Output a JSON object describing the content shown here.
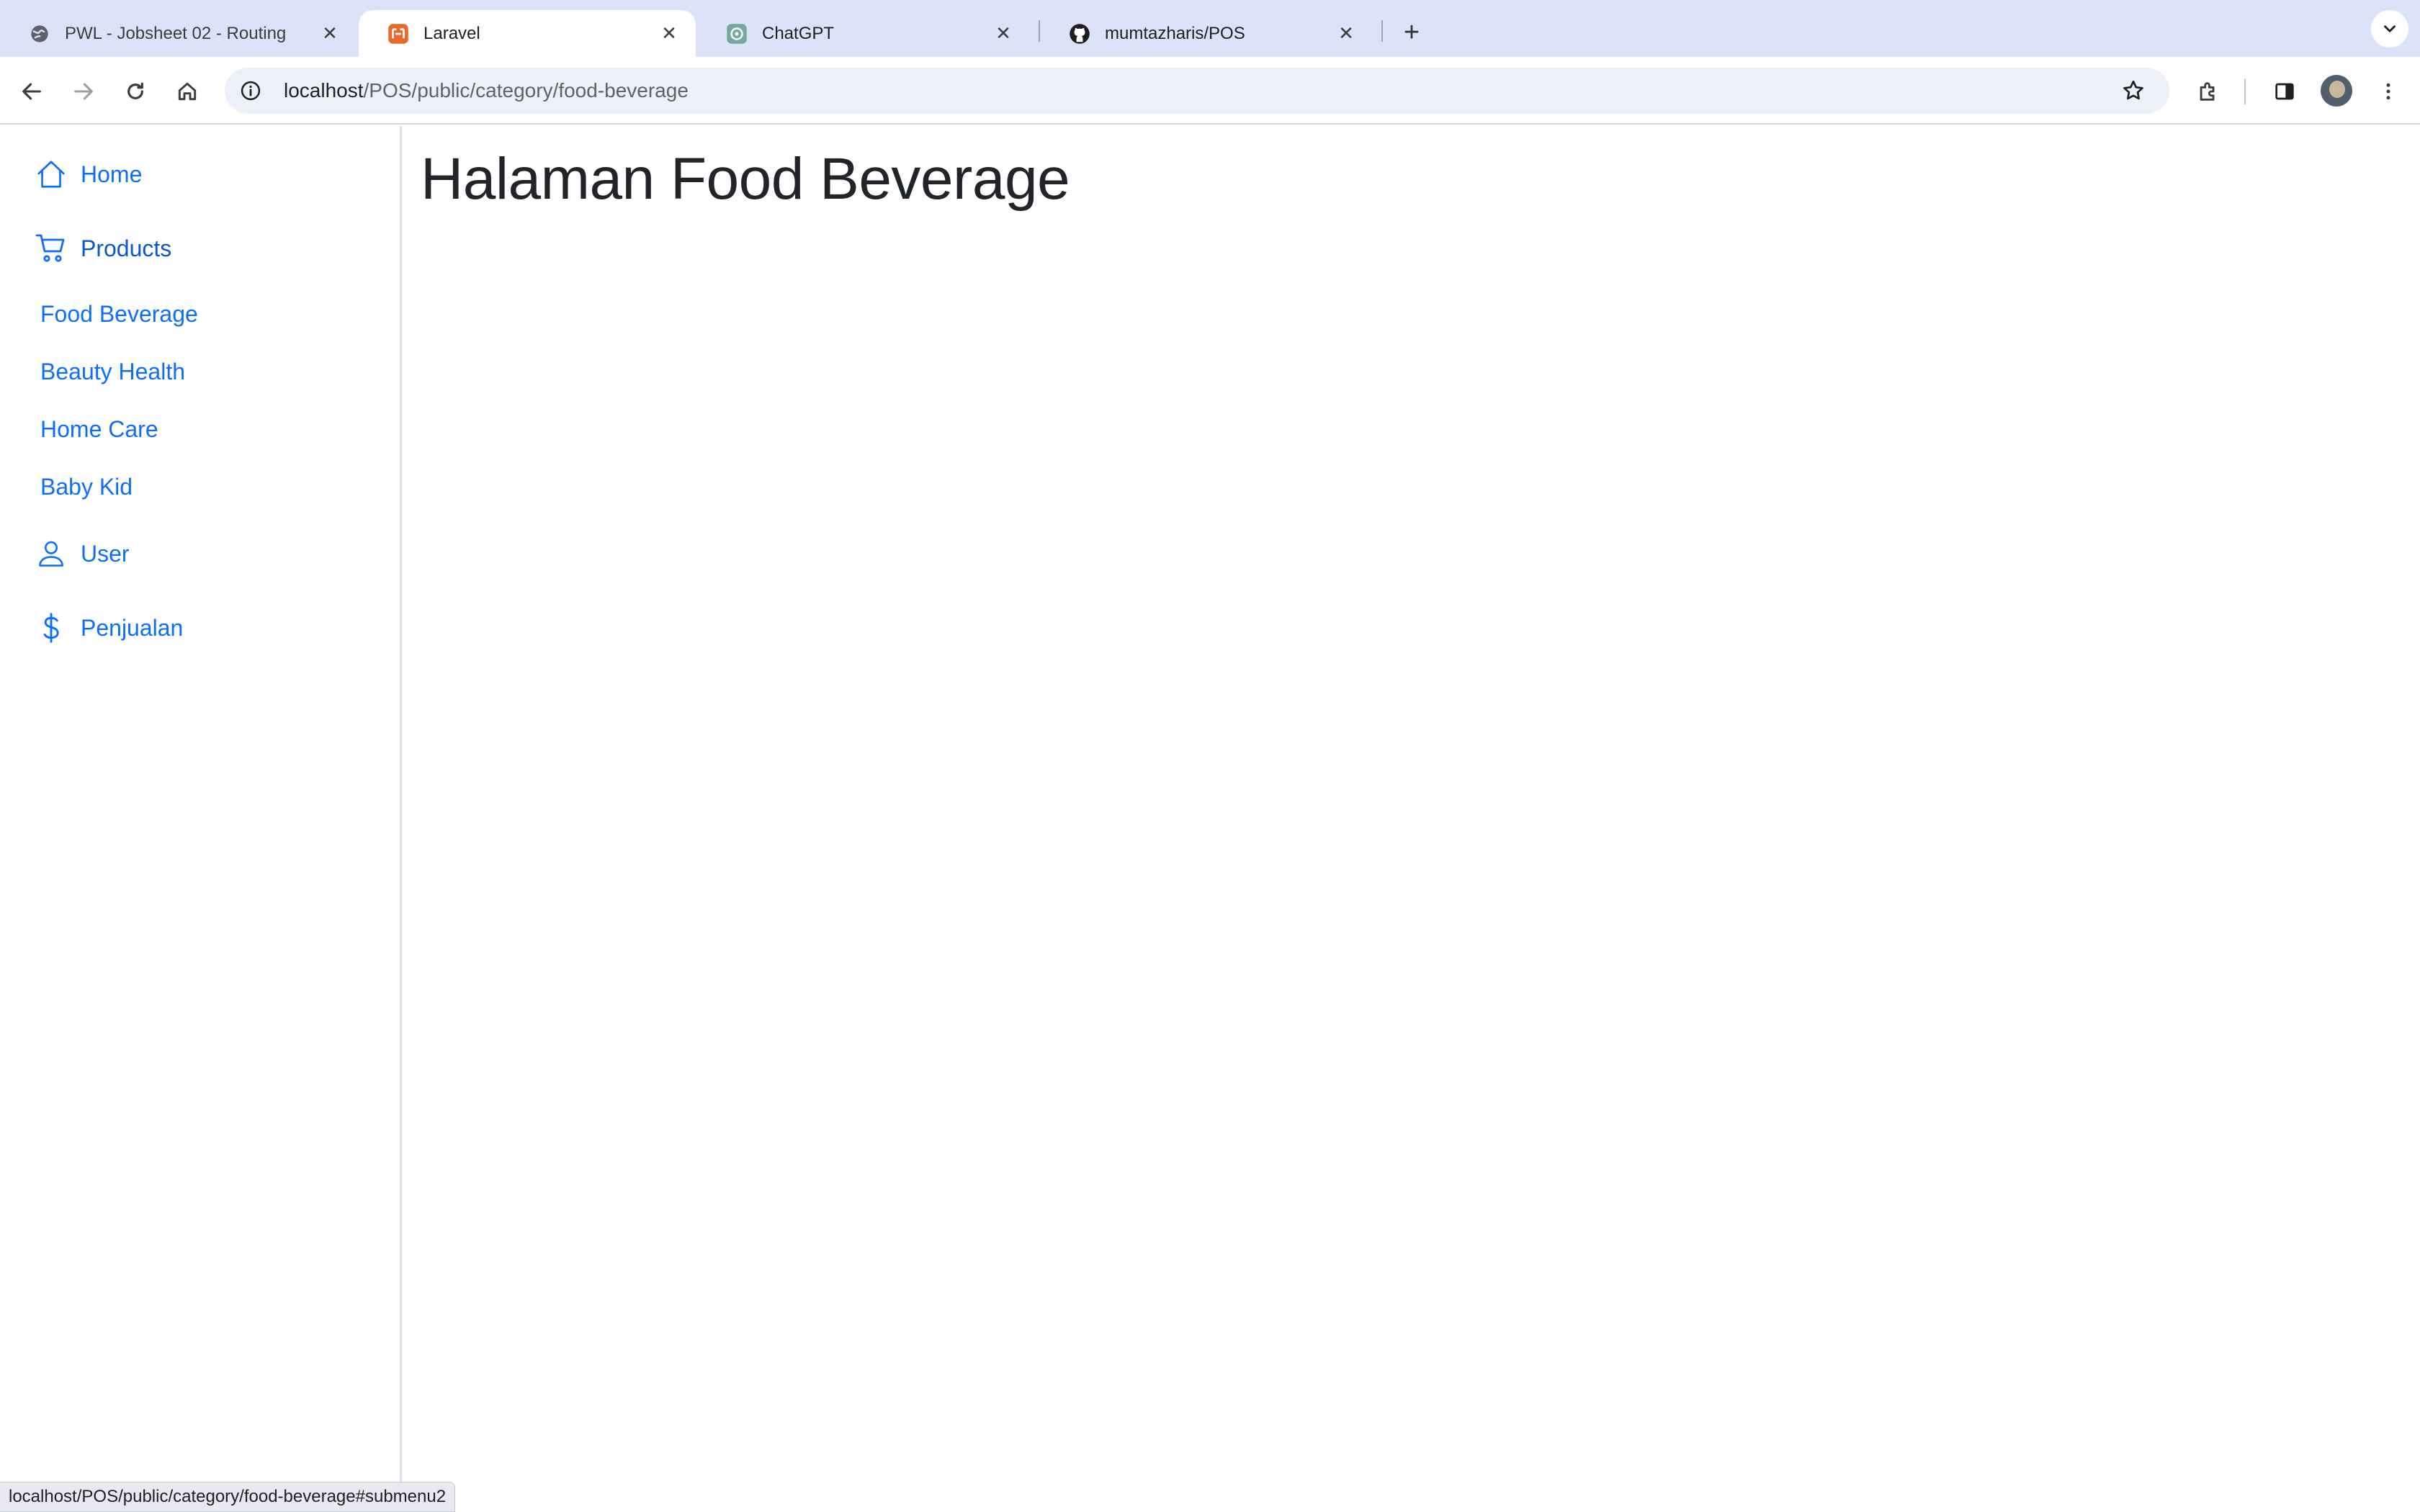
{
  "browser": {
    "tabs": [
      {
        "title": "PWL - Jobsheet 02 - Routing",
        "favicon": "globe-icon",
        "active": false
      },
      {
        "title": "Laravel",
        "favicon": "laravel-icon",
        "active": true
      },
      {
        "title": "ChatGPT",
        "favicon": "chatgpt-icon",
        "active": false
      },
      {
        "title": "mumtazharis/POS",
        "favicon": "github-icon",
        "active": false
      }
    ],
    "address": {
      "host": "localhost",
      "path": "/POS/public/category/food-beverage"
    },
    "status_url": "localhost/POS/public/category/food-beverage#submenu2"
  },
  "sidebar": {
    "home": {
      "label": "Home",
      "icon": "house-icon"
    },
    "products": {
      "label": "Products",
      "icon": "cart-icon"
    },
    "categories": [
      "Food Beverage",
      "Beauty Health",
      "Home Care",
      "Baby Kid"
    ],
    "user": {
      "label": "User",
      "icon": "person-icon"
    },
    "sales": {
      "label": "Penjualan",
      "icon": "dollar-icon"
    }
  },
  "main": {
    "title": "Halaman Food Beverage"
  },
  "colors": {
    "link": "#0d6efd",
    "heading": "#212529",
    "tabstrip": "#dae3f7"
  }
}
